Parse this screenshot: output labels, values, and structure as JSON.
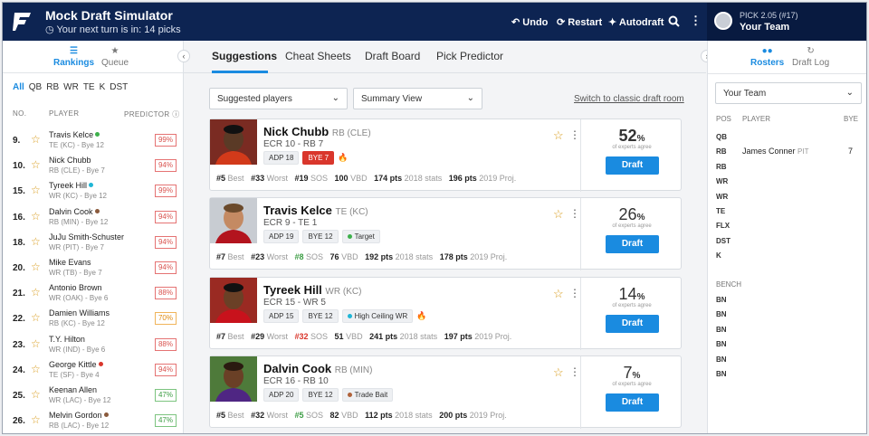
{
  "header": {
    "title": "Mock Draft Simulator",
    "turn_text": "Your next turn is in: 14 picks",
    "undo": "Undo",
    "restart": "Restart",
    "autodraft": "Autodraft",
    "pick_label": "PICK 2.05 (#17)",
    "team_label": "Your Team"
  },
  "left": {
    "tabs": [
      "Rankings",
      "Queue"
    ],
    "positions": [
      "All",
      "QB",
      "RB",
      "WR",
      "TE",
      "K",
      "DST"
    ],
    "col_no": "NO.",
    "col_player": "PLAYER",
    "col_predictor": "PREDICTOR",
    "players": [
      {
        "rank": "9.",
        "name": "Travis Kelce",
        "sub": "TE (KC) - Bye 12",
        "pct": "99%",
        "dot": "#3db04b",
        "tone": "r"
      },
      {
        "rank": "10.",
        "name": "Nick Chubb",
        "sub": "RB (CLE) - Bye 7",
        "pct": "94%",
        "dot": "",
        "tone": "r"
      },
      {
        "rank": "15.",
        "name": "Tyreek Hill",
        "sub": "WR (KC) - Bye 12",
        "pct": "99%",
        "dot": "#1fb6d6",
        "tone": "r"
      },
      {
        "rank": "16.",
        "name": "Dalvin Cook",
        "sub": "RB (MIN) - Bye 12",
        "pct": "94%",
        "dot": "#8a5a3c",
        "tone": "r"
      },
      {
        "rank": "18.",
        "name": "JuJu Smith-Schuster",
        "sub": "WR (PIT) - Bye 7",
        "pct": "94%",
        "dot": "",
        "tone": "r"
      },
      {
        "rank": "20.",
        "name": "Mike Evans",
        "sub": "WR (TB) - Bye 7",
        "pct": "94%",
        "dot": "",
        "tone": "r"
      },
      {
        "rank": "21.",
        "name": "Antonio Brown",
        "sub": "WR (OAK) - Bye 6",
        "pct": "88%",
        "dot": "",
        "tone": "r"
      },
      {
        "rank": "22.",
        "name": "Damien Williams",
        "sub": "RB (KC) - Bye 12",
        "pct": "70%",
        "dot": "",
        "tone": "o"
      },
      {
        "rank": "23.",
        "name": "T.Y. Hilton",
        "sub": "WR (IND) - Bye 6",
        "pct": "88%",
        "dot": "",
        "tone": "r"
      },
      {
        "rank": "24.",
        "name": "George Kittle",
        "sub": "TE (SF) - Bye 4",
        "pct": "94%",
        "dot": "#d9362c",
        "tone": "r"
      },
      {
        "rank": "25.",
        "name": "Keenan Allen",
        "sub": "WR (LAC) - Bye 12",
        "pct": "47%",
        "dot": "",
        "tone": "g"
      },
      {
        "rank": "26.",
        "name": "Melvin Gordon",
        "sub": "RB (LAC) - Bye 12",
        "pct": "47%",
        "dot": "#8a5a3c",
        "tone": "g"
      }
    ]
  },
  "center": {
    "tabs": [
      "Suggestions",
      "Cheat Sheets",
      "Draft Board",
      "Pick Predictor"
    ],
    "dd1": "Suggested players",
    "dd2": "Summary View",
    "classic_link": "Switch to classic draft room",
    "draft_label": "Draft",
    "agree_label": "of experts agree",
    "cards": [
      {
        "name": "Nick Chubb",
        "team": "RB (CLE)",
        "ecr": "ECR 10 - RB 7",
        "adp": "ADP 18",
        "bye": "BYE 7",
        "bye_red": true,
        "tag": "",
        "tag_dot": "",
        "fire": true,
        "best": "#5",
        "worst": "#33",
        "sos": "#19",
        "sos_color": "#222",
        "vbd": "100",
        "pts18": "174 pts",
        "pts19": "196 pts",
        "pct": "52",
        "bold": true
      },
      {
        "name": "Travis Kelce",
        "team": "TE (KC)",
        "ecr": "ECR 9 - TE 1",
        "adp": "ADP 19",
        "bye": "BYE 12",
        "bye_red": false,
        "tag": "Target",
        "tag_dot": "#3db04b",
        "fire": false,
        "best": "#7",
        "worst": "#23",
        "sos": "#8",
        "sos_color": "#3c9d44",
        "vbd": "76",
        "pts18": "192 pts",
        "pts19": "178 pts",
        "pct": "26",
        "bold": false
      },
      {
        "name": "Tyreek Hill",
        "team": "WR (KC)",
        "ecr": "ECR 15 - WR 5",
        "adp": "ADP 15",
        "bye": "BYE 12",
        "bye_red": false,
        "tag": "High Ceiling WR",
        "tag_dot": "#1fb6d6",
        "fire": true,
        "best": "#7",
        "worst": "#29",
        "sos": "#32",
        "sos_color": "#d9362c",
        "vbd": "51",
        "pts18": "241 pts",
        "pts19": "197 pts",
        "pct": "14",
        "bold": false
      },
      {
        "name": "Dalvin Cook",
        "team": "RB (MIN)",
        "ecr": "ECR 16 - RB 10",
        "adp": "ADP 20",
        "bye": "BYE 12",
        "bye_red": false,
        "tag": "Trade Bait",
        "tag_dot": "#b0623a",
        "fire": false,
        "best": "#5",
        "worst": "#32",
        "sos": "#5",
        "sos_color": "#3c9d44",
        "vbd": "82",
        "pts18": "112 pts",
        "pts19": "200 pts",
        "pct": "7",
        "bold": false
      }
    ],
    "stat_labels": {
      "best": "Best",
      "worst": "Worst",
      "sos": "SOS",
      "vbd": "VBD",
      "s18": "2018 stats",
      "s19": "2019 Proj."
    }
  },
  "right": {
    "tabs": [
      "Rosters",
      "Draft Log"
    ],
    "team_select": "Your Team",
    "col_pos": "POS",
    "col_player": "PLAYER",
    "col_bye": "BYE",
    "starters": [
      "QB",
      "RB",
      "RB",
      "WR",
      "WR",
      "TE",
      "FLX",
      "DST",
      "K"
    ],
    "player": "James Conner",
    "player_team": "PIT",
    "player_bye": "7",
    "bench_label": "BENCH",
    "bench": [
      "BN",
      "BN",
      "BN",
      "BN",
      "BN",
      "BN"
    ]
  },
  "colors": {
    "navy": "#0d2452",
    "accent": "#1a8be0",
    "star": "#d89b1a"
  }
}
